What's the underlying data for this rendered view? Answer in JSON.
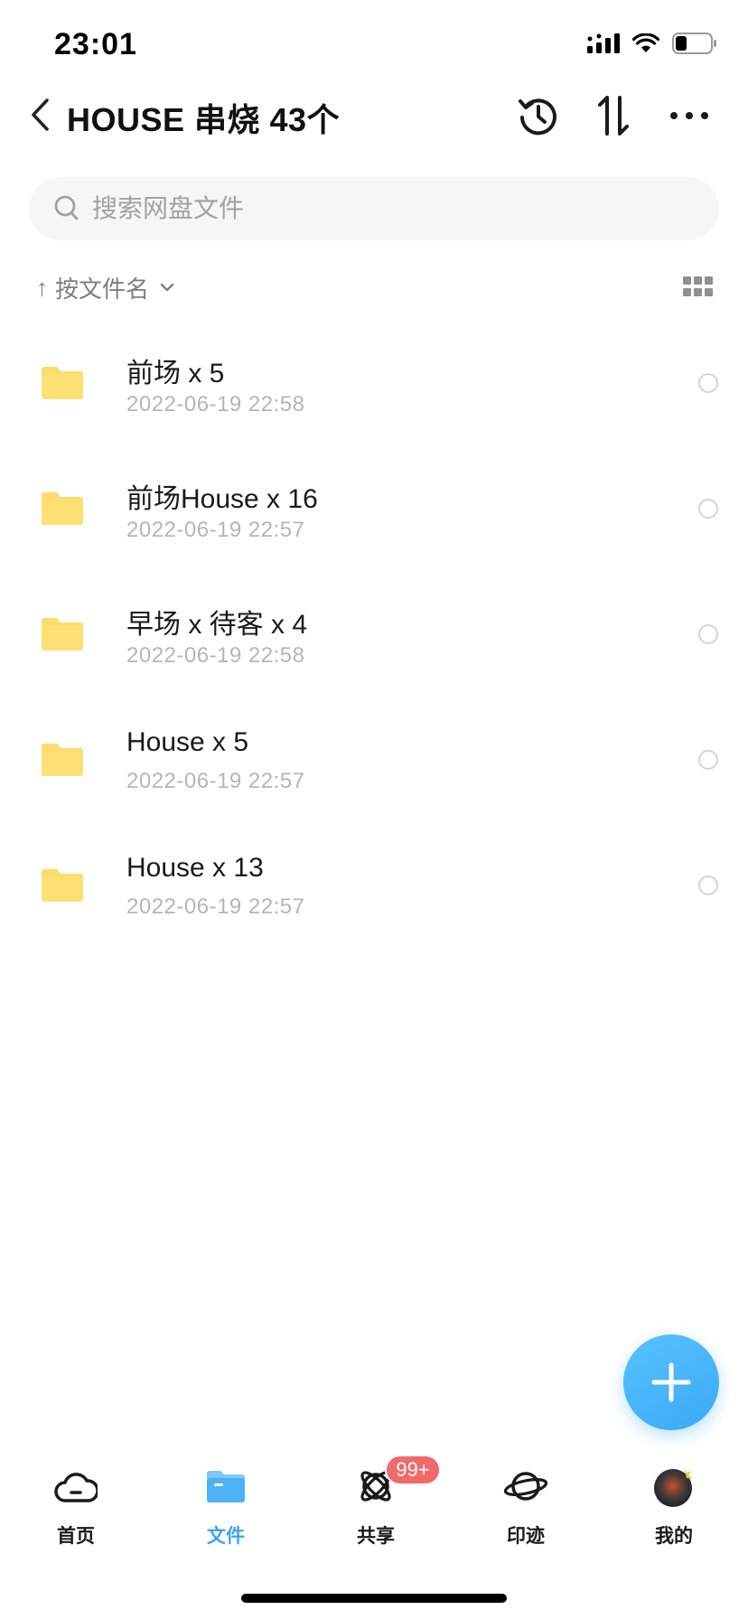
{
  "status_bar": {
    "time": "23:01",
    "icons": [
      "cellular-signal-icon",
      "wifi-icon",
      "battery-icon"
    ]
  },
  "nav": {
    "back_icon": "chevron-left-icon",
    "title": "HOUSE 串烧 43个",
    "actions": [
      "history-icon",
      "sort-arrows-icon",
      "more-icon"
    ]
  },
  "search": {
    "placeholder": "搜索网盘文件",
    "value": ""
  },
  "sort": {
    "direction": "↑",
    "label": "按文件名"
  },
  "files": [
    {
      "name": "前场 x 5",
      "date": "2022-06-19 22:58"
    },
    {
      "name": "前场House x 16",
      "date": "2022-06-19 22:57"
    },
    {
      "name": "早场 x 待客 x 4",
      "date": "2022-06-19 22:58"
    },
    {
      "name": "House x 5",
      "date": "2022-06-19 22:57"
    },
    {
      "name": "House x 13",
      "date": "2022-06-19 22:57"
    }
  ],
  "fab": {
    "icon": "plus-icon"
  },
  "tabs": [
    {
      "label": "首页",
      "icon": "cloud-home-icon",
      "active": false
    },
    {
      "label": "文件",
      "icon": "folder-icon",
      "active": true
    },
    {
      "label": "共享",
      "icon": "share-orbit-icon",
      "active": false,
      "badge": "99+"
    },
    {
      "label": "印迹",
      "icon": "planet-icon",
      "active": false
    },
    {
      "label": "我的",
      "icon": "avatar",
      "active": false
    }
  ],
  "colors": {
    "accent": "#3aa3f0",
    "folder": "#fddc6c",
    "badge": "#f06a6a",
    "secondary_text": "#b3b6bb"
  }
}
